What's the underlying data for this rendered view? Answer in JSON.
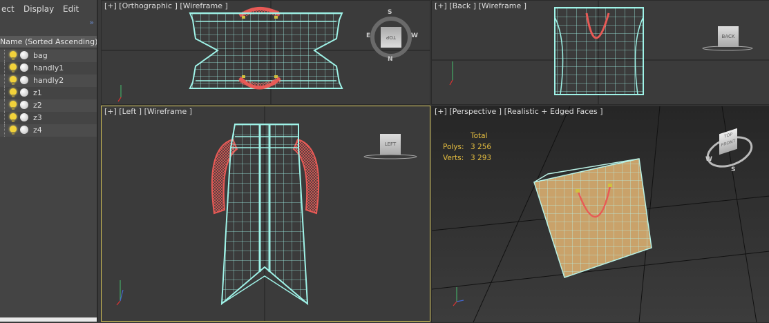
{
  "menu": {
    "item1": "ect",
    "item2": "Display",
    "item3": "Edit"
  },
  "scene_explorer": {
    "column_header": "Name (Sorted Ascending)",
    "items": [
      "bag",
      "handly1",
      "handly2",
      "z1",
      "z2",
      "z3",
      "z4"
    ]
  },
  "viewports": {
    "top": {
      "label": "[+] [Orthographic ] [Wireframe ]",
      "cube": "TOP",
      "compass": {
        "n": "N",
        "s": "S",
        "w": "W",
        "e": "E"
      }
    },
    "back": {
      "label": "[+] [Back ] [Wireframe ]",
      "cube": "BACK"
    },
    "left": {
      "label": "[+] [Left ] [Wireframe ]",
      "cube": "LEFT"
    },
    "perspective": {
      "label": "[+] [Perspective ] [Realistic + Edged Faces ]",
      "cube_top": "TOP",
      "cube_front": "FRONT",
      "compass": {
        "w": "W",
        "s": "S"
      },
      "stats": {
        "header": "Total",
        "polys_label": "Polys:",
        "polys": "3 256",
        "verts_label": "Verts:",
        "verts": "3 293"
      }
    }
  },
  "colors": {
    "wire": "#9ff3e8",
    "handle": "#e85a56",
    "bag_fill": "#c9a26a",
    "active_border": "#d8c75a"
  }
}
